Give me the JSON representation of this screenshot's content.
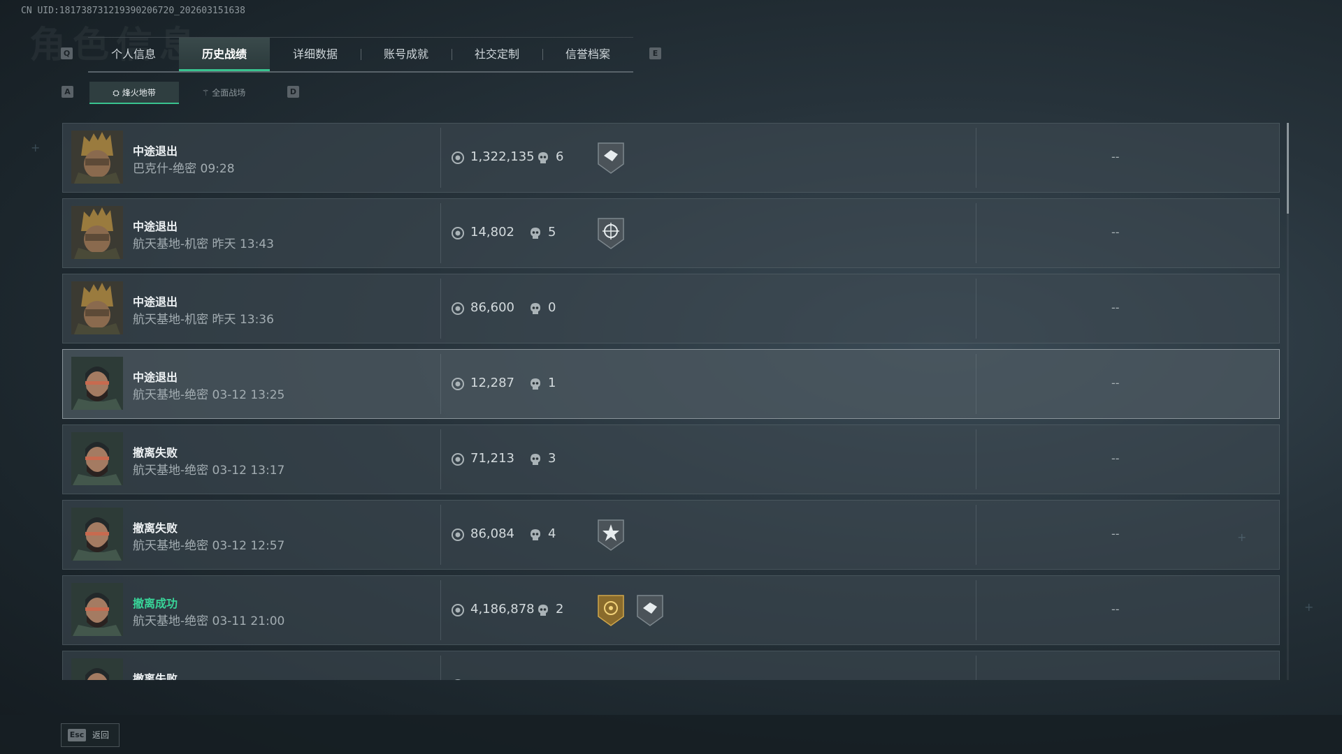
{
  "uid": "CN UID:181738731219390206720_202603151638",
  "bg_title": "角色信息",
  "keys": {
    "prev_tab": "Q",
    "next_tab": "E",
    "prev_sub": "A",
    "next_sub": "D",
    "esc": "Esc"
  },
  "tabs": [
    "个人信息",
    "历史战绩",
    "详细数据",
    "账号成就",
    "社交定制",
    "信誉档案"
  ],
  "active_tab": "历史战绩",
  "subtabs": [
    "烽火地带",
    "全面战场"
  ],
  "rows": [
    {
      "status": "中途退出",
      "detail": "巴克什-绝密 09:28",
      "money": "1,322,135",
      "kills": "6",
      "result": "--"
    },
    {
      "status": "中途退出",
      "detail": "航天基地-机密 昨天 13:43",
      "money": "14,802",
      "kills": "5",
      "result": "--"
    },
    {
      "status": "中途退出",
      "detail": "航天基地-机密 昨天 13:36",
      "money": "86,600",
      "kills": "0",
      "result": "--"
    },
    {
      "status": "中途退出",
      "detail": "航天基地-绝密 03-12 13:25",
      "money": "12,287",
      "kills": "1",
      "result": "--"
    },
    {
      "status": "撤离失败",
      "detail": "航天基地-绝密 03-12 13:17",
      "money": "71,213",
      "kills": "3",
      "result": "--"
    },
    {
      "status": "撤离失败",
      "detail": "航天基地-绝密 03-12 12:57",
      "money": "86,084",
      "kills": "4",
      "result": "--"
    },
    {
      "status": "撤离成功",
      "detail": "航天基地-绝密 03-11 21:00",
      "money": "4,186,878",
      "kills": "2",
      "result": "--"
    },
    {
      "status": "撤离失败",
      "detail": "",
      "money": "",
      "kills": "",
      "result": ""
    }
  ],
  "footer": {
    "back_label": "返回"
  },
  "colors": {
    "accent": "#39c38f",
    "success": "#38d498"
  }
}
